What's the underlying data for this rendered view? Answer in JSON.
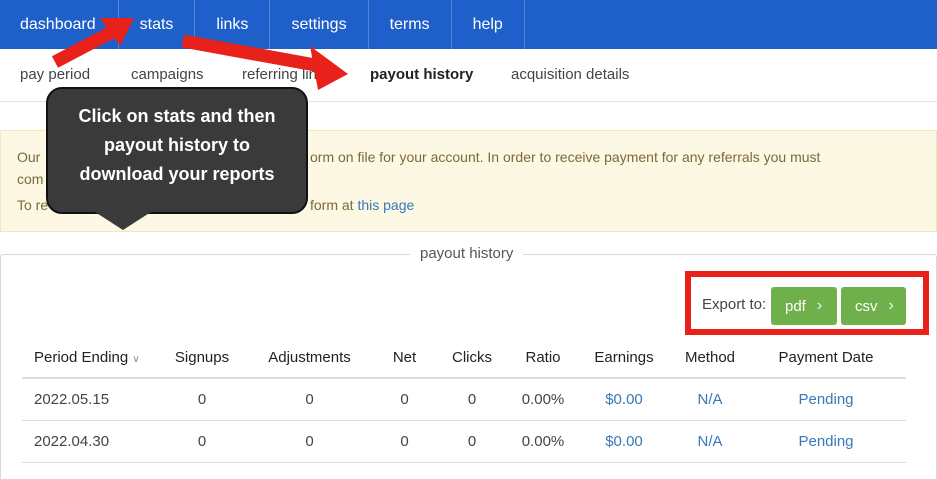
{
  "topnav": {
    "items": [
      "dashboard",
      "stats",
      "links",
      "settings",
      "terms",
      "help"
    ]
  },
  "subnav": {
    "items": [
      "pay period",
      "campaigns",
      "referring links",
      "payout history",
      "acquisition details"
    ]
  },
  "notice": {
    "line1_start": "Our",
    "line1_end": "orm on file for your account. In order to receive payment for any referrals you must",
    "line2_start": "com",
    "line3_start": "To re",
    "line3_mid": "form at",
    "link_text": "this page"
  },
  "callout": {
    "line1": "Click on stats and then",
    "line2": "payout history to",
    "line3": "download your reports"
  },
  "panel": {
    "title": "payout history",
    "export_label": "Export to:",
    "pdf_label": "pdf",
    "csv_label": "csv"
  },
  "table": {
    "headers": [
      "Period Ending",
      "Signups",
      "Adjustments",
      "Net",
      "Clicks",
      "Ratio",
      "Earnings",
      "Method",
      "Payment Date"
    ],
    "sort_indicator": "∨",
    "rows": [
      [
        "2022.05.15",
        "0",
        "0",
        "0",
        "0",
        "0.00%",
        "$0.00",
        "N/A",
        "Pending"
      ],
      [
        "2022.04.30",
        "0",
        "0",
        "0",
        "0",
        "0.00%",
        "$0.00",
        "N/A",
        "Pending"
      ]
    ]
  },
  "colors": {
    "nav": "#1f5fc9",
    "arrow": "#e8211b",
    "button": "#6fb04a",
    "link": "#3778b8"
  }
}
